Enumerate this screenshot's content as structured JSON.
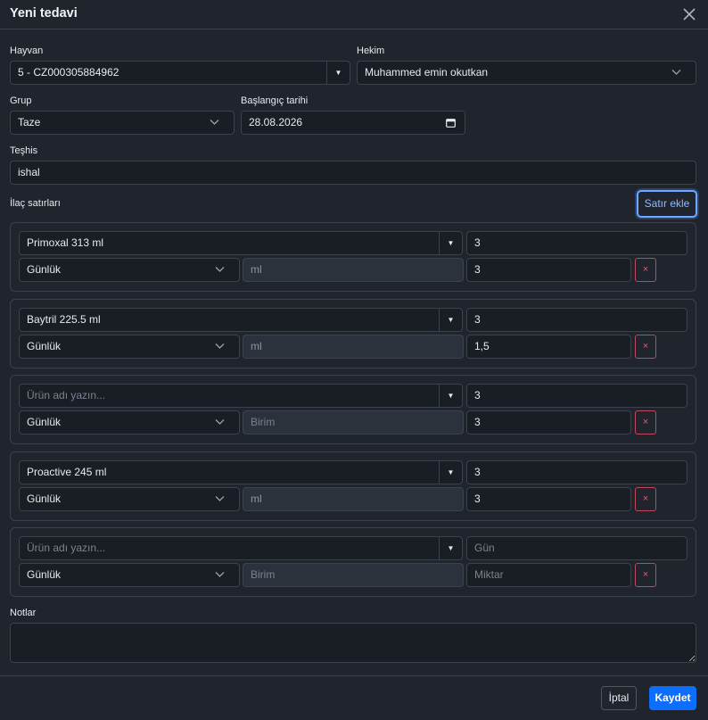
{
  "dialog": {
    "title": "Yeni tedavi"
  },
  "form": {
    "animal": {
      "label": "Hayvan",
      "value": "5 - CZ000305884962"
    },
    "vet": {
      "label": "Hekim",
      "value": "Muhammed emin okutkan"
    },
    "group": {
      "label": "Grup",
      "value": "Taze"
    },
    "start_date": {
      "label": "Başlangıç tarihi",
      "value": "28.08.2026"
    },
    "diagnosis": {
      "label": "Teşhis",
      "value": "ishal"
    },
    "med_lines_label": "İlaç satırları",
    "add_row_label": "Satır ekle",
    "notes_label": "Notlar"
  },
  "med_lines": [
    {
      "product": "Primoxal 313 ml",
      "product_placeholder": "Ürün adı yazın...",
      "days": "3",
      "days_placeholder": "Gün",
      "frequency": "Günlük",
      "unit": "ml",
      "unit_placeholder": "Birim",
      "quantity": "3",
      "quantity_placeholder": "Miktar",
      "delete": "×"
    },
    {
      "product": "Baytril 225.5 ml",
      "product_placeholder": "Ürün adı yazın...",
      "days": "3",
      "days_placeholder": "Gün",
      "frequency": "Günlük",
      "unit": "ml",
      "unit_placeholder": "Birim",
      "quantity": "1,5",
      "quantity_placeholder": "Miktar",
      "delete": "×"
    },
    {
      "product": "",
      "product_placeholder": "Ürün adı yazın...",
      "days": "3",
      "days_placeholder": "Gün",
      "frequency": "Günlük",
      "unit": "",
      "unit_placeholder": "Birim",
      "quantity": "3",
      "quantity_placeholder": "Miktar",
      "delete": "×"
    },
    {
      "product": "Proactive 245 ml",
      "product_placeholder": "Ürün adı yazın...",
      "days": "3",
      "days_placeholder": "Gün",
      "frequency": "Günlük",
      "unit": "ml",
      "unit_placeholder": "Birim",
      "quantity": "3",
      "quantity_placeholder": "Miktar",
      "delete": "×"
    },
    {
      "product": "",
      "product_placeholder": "Ürün adı yazın...",
      "days": "",
      "days_placeholder": "Gün",
      "frequency": "Günlük",
      "unit": "",
      "unit_placeholder": "Birim",
      "quantity": "",
      "quantity_placeholder": "Miktar",
      "delete": "×"
    }
  ],
  "footer": {
    "cancel_label": "İptal",
    "save_label": "Kaydet"
  },
  "colors": {
    "background": "#1f242d",
    "field": "#191d24",
    "border": "#3b424d",
    "primary": "#0d6efd",
    "danger": "#c0485a"
  }
}
